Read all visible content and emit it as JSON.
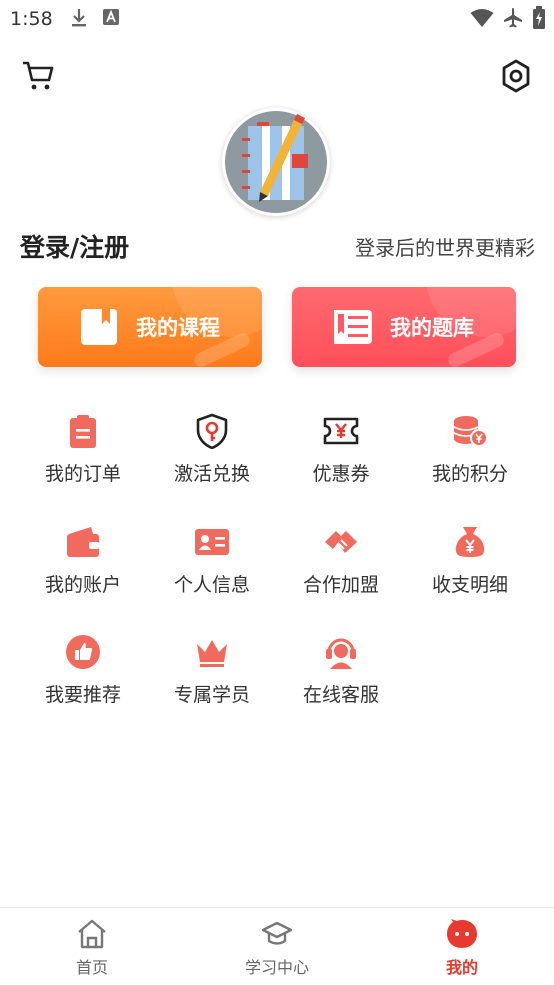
{
  "status_bar": {
    "time": "1:58"
  },
  "header": {
    "login_title": "登录/注册",
    "login_hint": "登录后的世界更精彩"
  },
  "buttons": {
    "courses_label": "我的课程",
    "questions_label": "我的题库"
  },
  "grid": [
    {
      "label": "我的订单",
      "icon": "clipboard-icon"
    },
    {
      "label": "激活兑换",
      "icon": "shield-key-icon"
    },
    {
      "label": "优惠券",
      "icon": "coupon-icon"
    },
    {
      "label": "我的积分",
      "icon": "coins-icon"
    },
    {
      "label": "我的账户",
      "icon": "wallet-icon"
    },
    {
      "label": "个人信息",
      "icon": "id-card-icon"
    },
    {
      "label": "合作加盟",
      "icon": "handshake-icon"
    },
    {
      "label": "收支明细",
      "icon": "money-bag-icon"
    },
    {
      "label": "我要推荐",
      "icon": "thumbs-up-icon"
    },
    {
      "label": "专属学员",
      "icon": "crown-icon"
    },
    {
      "label": "在线客服",
      "icon": "headset-icon"
    }
  ],
  "bottom_nav": [
    {
      "label": "首页",
      "icon": "home-icon",
      "active": false
    },
    {
      "label": "学习中心",
      "icon": "graduation-cap-icon",
      "active": false
    },
    {
      "label": "我的",
      "icon": "profile-face-icon",
      "active": true
    }
  ],
  "colors": {
    "accent": "#e8392e",
    "icon_red": "#f06a5e",
    "courses_btn": "#ff8a2a",
    "questions_btn": "#ff5a63"
  }
}
